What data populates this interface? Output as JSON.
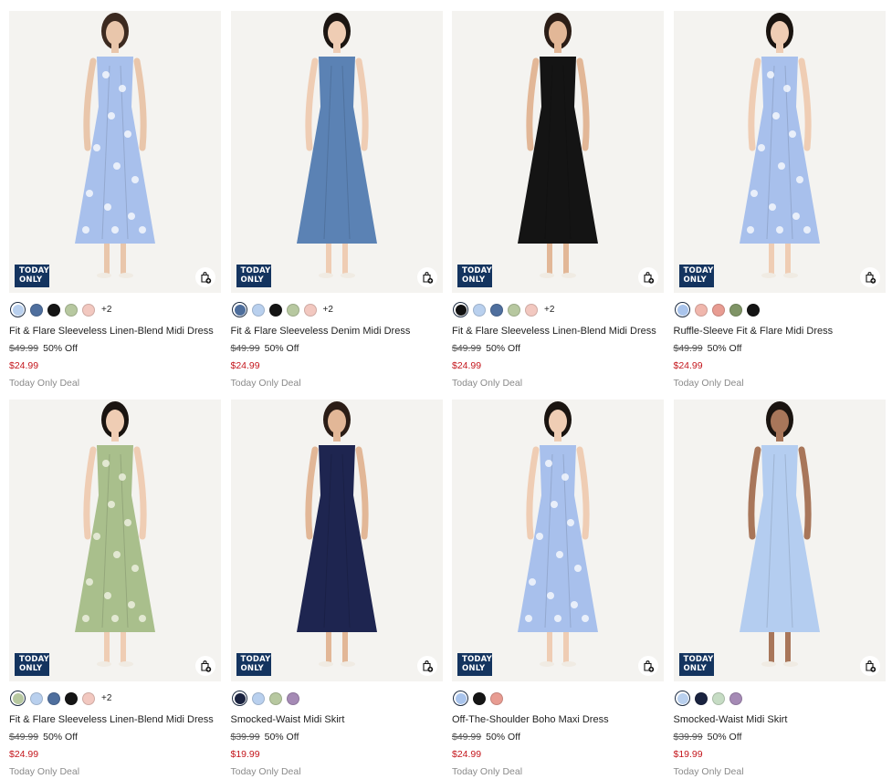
{
  "badge": {
    "line1": "TODAY",
    "line2": "ONLY"
  },
  "products": [
    {
      "name": "Fit & Flare Sleeveless Linen-Blend Midi Dress",
      "original_price": "$49.99",
      "discount": "50% Off",
      "sale_price": "$24.99",
      "deal_label": "Today Only Deal",
      "swatches": [
        "#b9d0ee",
        "#4f6f9e",
        "#151515",
        "#b7c8a0",
        "#f2c8c0"
      ],
      "selected_swatch": 0,
      "more": "+2",
      "dress_color": "#a8c0ec",
      "pattern": "#ffffff",
      "skin": "#e9c6ab",
      "hair": "#3c2a20"
    },
    {
      "name": "Fit & Flare Sleeveless Denim Midi Dress",
      "original_price": "$49.99",
      "discount": "50% Off",
      "sale_price": "$24.99",
      "deal_label": "Today Only Deal",
      "swatches": [
        "#4e6e9c",
        "#b9d0ee",
        "#151515",
        "#b7c8a0",
        "#f2c8c0"
      ],
      "selected_swatch": 0,
      "more": "+2",
      "dress_color": "#5b82b4",
      "pattern": "",
      "skin": "#efcdb4",
      "hair": "#1c1612"
    },
    {
      "name": "Fit & Flare Sleeveless Linen-Blend Midi Dress",
      "original_price": "$49.99",
      "discount": "50% Off",
      "sale_price": "$24.99",
      "deal_label": "Today Only Deal",
      "swatches": [
        "#111111",
        "#b9d0ee",
        "#4f6f9e",
        "#b7c8a0",
        "#f2c8c0"
      ],
      "selected_swatch": 0,
      "more": "+2",
      "dress_color": "#141414",
      "pattern": "",
      "skin": "#e2b797",
      "hair": "#2b1d16"
    },
    {
      "name": "Ruffle-Sleeve Fit & Flare Midi Dress",
      "original_price": "$49.99",
      "discount": "50% Off",
      "sale_price": "$24.99",
      "deal_label": "Today Only Deal",
      "swatches": [
        "#a9c4ec",
        "#f0b7ad",
        "#e89c92",
        "#7f9466",
        "#151515"
      ],
      "selected_swatch": 0,
      "more": "",
      "dress_color": "#a8c0ec",
      "pattern": "#ffffff",
      "skin": "#efcdb4",
      "hair": "#1a1410"
    },
    {
      "name": "Fit & Flare Sleeveless Linen-Blend Midi Dress",
      "original_price": "$49.99",
      "discount": "50% Off",
      "sale_price": "$24.99",
      "deal_label": "Today Only Deal",
      "swatches": [
        "#b7c8a0",
        "#b9d0ee",
        "#4f6f9e",
        "#151515",
        "#f2c8c0"
      ],
      "selected_swatch": 0,
      "more": "+2",
      "dress_color": "#a9bf8c",
      "pattern": "#f5f5ea",
      "skin": "#efcdb4",
      "hair": "#1a1410"
    },
    {
      "name": "Smocked-Waist Midi Skirt",
      "original_price": "$39.99",
      "discount": "50% Off",
      "sale_price": "$19.99",
      "deal_label": "Today Only Deal",
      "swatches": [
        "#1a2340",
        "#b9d0ee",
        "#b7c8a0",
        "#a58ab5"
      ],
      "selected_swatch": 0,
      "more": "",
      "dress_color": "#1e2550",
      "pattern": "",
      "skin": "#e2b797",
      "hair": "#2b1d16"
    },
    {
      "name": "Off-The-Shoulder Boho Maxi Dress",
      "original_price": "$49.99",
      "discount": "50% Off",
      "sale_price": "$24.99",
      "deal_label": "Today Only Deal",
      "swatches": [
        "#a9c4ec",
        "#151515",
        "#e89c92"
      ],
      "selected_swatch": 0,
      "more": "",
      "dress_color": "#a8c0ec",
      "pattern": "#ffffff",
      "skin": "#efcdb4",
      "hair": "#1a1410"
    },
    {
      "name": "Smocked-Waist Midi Skirt",
      "original_price": "$39.99",
      "discount": "50% Off",
      "sale_price": "$19.99",
      "deal_label": "Today Only Deal",
      "swatches": [
        "#b9d0ee",
        "#1a2340",
        "#c6dcc4",
        "#a58ab5"
      ],
      "selected_swatch": 0,
      "more": "",
      "dress_color": "#b4cdf0",
      "pattern": "",
      "skin": "#a8765a",
      "hair": "#1a1410"
    }
  ]
}
